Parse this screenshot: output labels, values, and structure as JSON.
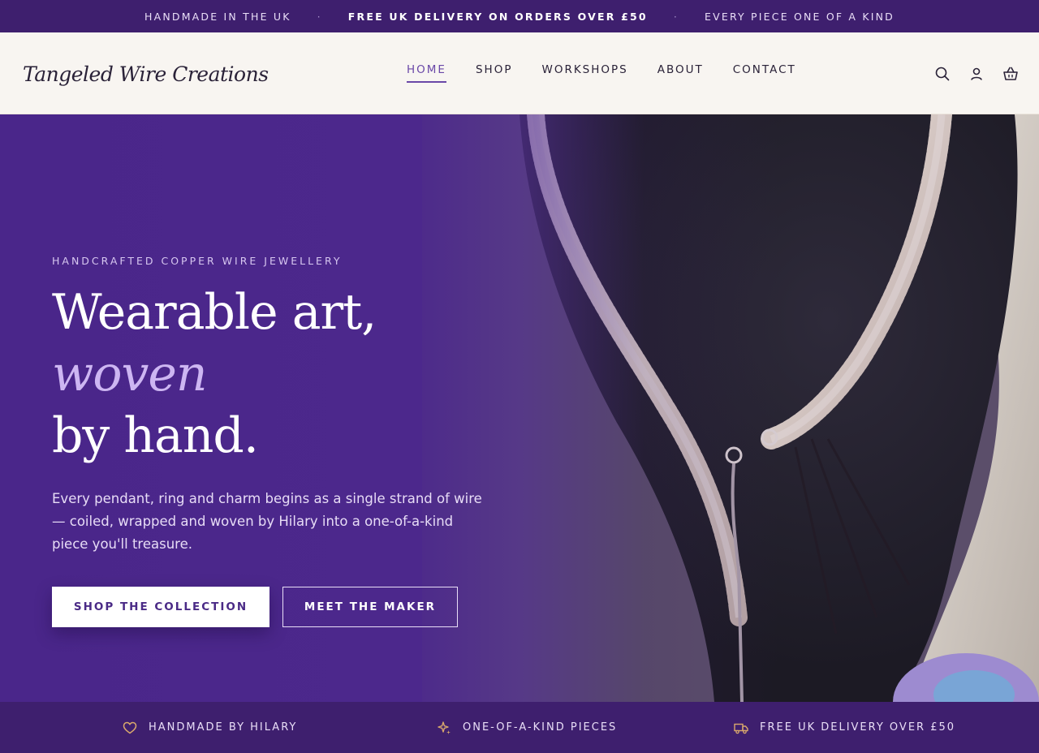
{
  "announcement": {
    "messages": [
      "HANDMADE IN THE UK",
      "FREE UK DELIVERY ON ORDERS OVER £50",
      "EVERY PIECE ONE OF A KIND"
    ],
    "separator": "·"
  },
  "header": {
    "logo_text": "Tangeled Wire Creations",
    "nav": [
      "HOME",
      "SHOP",
      "WORKSHOPS",
      "ABOUT",
      "CONTACT"
    ],
    "active_nav": "HOME",
    "icons": [
      "search-icon",
      "account-icon",
      "basket-icon"
    ]
  },
  "hero": {
    "eyebrow": "HANDCRAFTED COPPER WIRE JEWELLERY",
    "headline_part1": "Wearable art, ",
    "headline_accent": "woven",
    "headline_part2": "by hand.",
    "intro": "Every pendant, ring and charm begins as a single strand of wire — coiled, wrapped and woven by Hilary into a one-of-a-kind piece you'll treasure.",
    "primary_cta": "SHOP THE COLLECTION",
    "secondary_cta": "MEET THE MAKER"
  },
  "features": [
    {
      "icon": "heart-icon",
      "label": "HANDMADE BY HILARY"
    },
    {
      "icon": "sparkle-icon",
      "label": "ONE-OF-A-KIND PIECES"
    },
    {
      "icon": "truck-icon",
      "label": "FREE UK DELIVERY OVER £50"
    }
  ],
  "colors": {
    "brand_purple": "#3e1f6e",
    "hero_purple": "#4a268a",
    "accent_lilac": "#cdb6f2",
    "nav_active": "#6a48a8",
    "icon_gold": "#d9a86c"
  }
}
